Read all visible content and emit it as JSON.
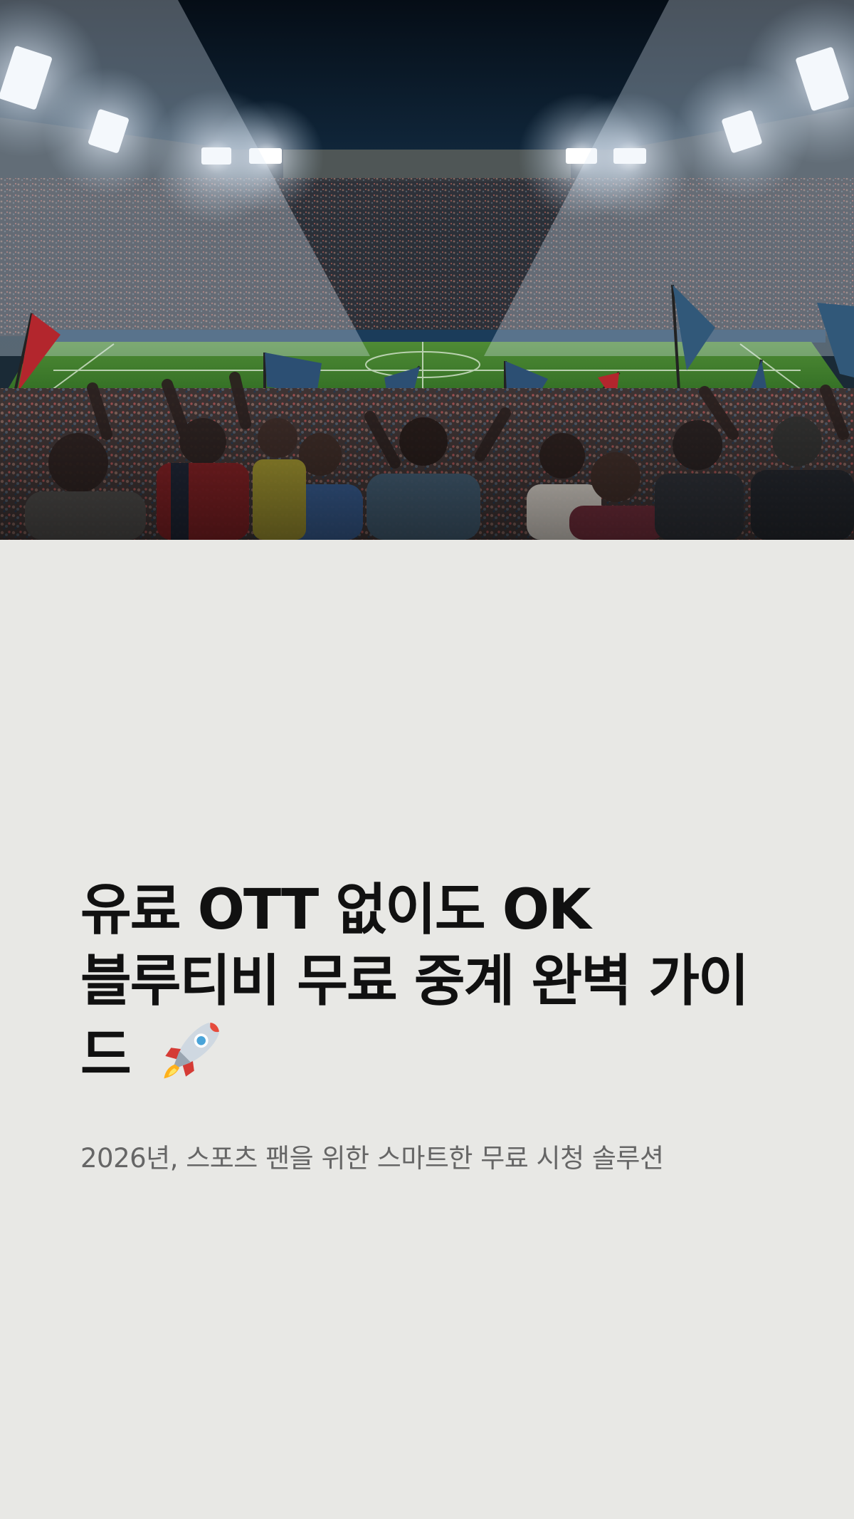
{
  "hero": {
    "image": "soccer-stadium-fans-night-lights",
    "accent_colors": {
      "sky": "#07111c",
      "pitch": "#4f8b35",
      "floodlight": "#ffffff",
      "flag_blue": "#2c4f73",
      "flag_red": "#b3262d"
    }
  },
  "article": {
    "title_lines": [
      "유료 OTT 없이도 OK",
      "블루티비 무료 중계 완벽 가이",
      "드"
    ],
    "title_icon": "rocket-icon",
    "subtitle": "2026년, 스포츠 팬을 위한 스마트한 무료 시청 솔루션"
  }
}
